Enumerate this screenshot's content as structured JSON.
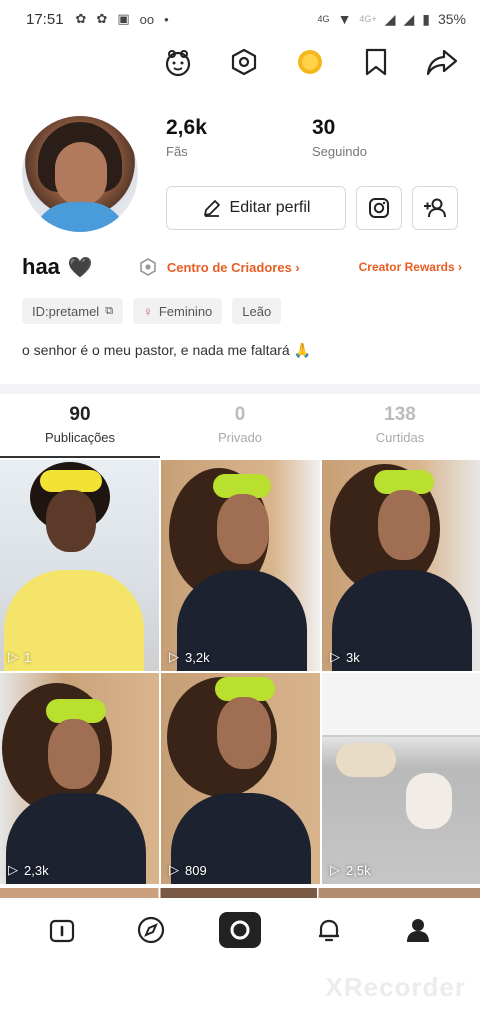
{
  "status_bar": {
    "time": "17:51",
    "network": "4G",
    "network2": "4G+",
    "battery": "35%"
  },
  "profile": {
    "name": "haa",
    "fans_value": "2,6k",
    "fans_label": "Fãs",
    "following_value": "30",
    "following_label": "Seguindo",
    "edit_button": "Editar perfil",
    "creator_center": "Centro de Criadores",
    "creator_rewards": "Creator Rewards",
    "tags": [
      {
        "label": "ID:pretamel",
        "icon": "copy-icon"
      },
      {
        "label": "Feminino",
        "icon": "female-icon"
      },
      {
        "label": "Leão",
        "icon": ""
      }
    ],
    "bio": "o senhor é o meu pastor, e nada me faltará 🙏"
  },
  "tabs": [
    {
      "count": "90",
      "label": "Publicações",
      "active": true
    },
    {
      "count": "0",
      "label": "Privado",
      "active": false
    },
    {
      "count": "138",
      "label": "Curtidas",
      "active": false
    }
  ],
  "videos": [
    {
      "views": "1",
      "theme": "yellow"
    },
    {
      "views": "3,2k",
      "theme": "green"
    },
    {
      "views": "3k",
      "theme": "green"
    },
    {
      "views": "2,3k",
      "theme": "green"
    },
    {
      "views": "809",
      "theme": "green"
    },
    {
      "views": "2,5k",
      "theme": "dog"
    }
  ],
  "bottom_nav": [
    {
      "name": "nav-home",
      "icon": "home-icon"
    },
    {
      "name": "nav-discover",
      "icon": "compass-icon"
    },
    {
      "name": "nav-camera",
      "icon": "camera-icon"
    },
    {
      "name": "nav-notifications",
      "icon": "bell-icon"
    },
    {
      "name": "nav-profile",
      "icon": "profile-icon"
    }
  ],
  "colors": {
    "accent": "#e85d23",
    "text": "#222222"
  }
}
